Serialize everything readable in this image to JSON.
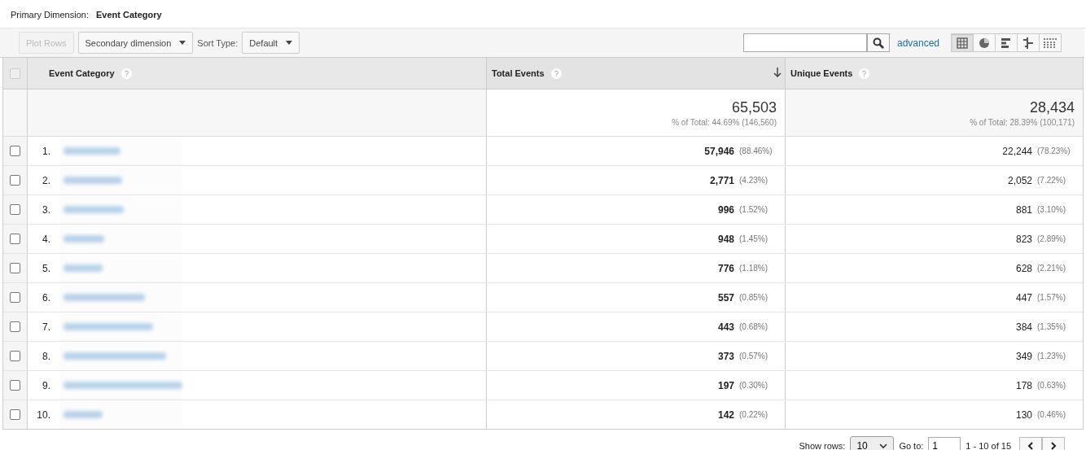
{
  "primary_dimension": {
    "label": "Primary Dimension:",
    "value": "Event Category"
  },
  "toolbar": {
    "plot_rows": {
      "label": "Plot Rows",
      "disabled": true
    },
    "secondary": "Secondary dimension",
    "sort_label": "Sort Type:",
    "sort_value": "Default",
    "advanced": "advanced",
    "views": [
      {
        "kind": "table",
        "selected": true
      },
      {
        "kind": "pie",
        "selected": false
      },
      {
        "kind": "bars",
        "selected": false
      },
      {
        "kind": "comparison",
        "selected": false
      },
      {
        "kind": "pivot",
        "selected": false
      }
    ]
  },
  "table": {
    "select_all_checked": false,
    "columns": [
      {
        "label": "Event Category",
        "sorted": false
      },
      {
        "label": "Total Events",
        "sorted": true
      },
      {
        "label": "Unique Events",
        "sorted": false
      }
    ],
    "totals": [
      {
        "value": "65,503",
        "detail": "% of Total: 44.69% (146,560)"
      },
      {
        "value": "28,434",
        "detail": "% of Total: 28.39% (100,171)"
      }
    ],
    "rows": [
      {
        "index": "1.",
        "checked": false,
        "total": "57,946",
        "total_pct": "(88.46%)",
        "unique": "22,244",
        "unique_pct": "(78.23%)"
      },
      {
        "index": "2.",
        "checked": false,
        "total": "2,771",
        "total_pct": "(4.23%)",
        "unique": "2,052",
        "unique_pct": "(7.22%)"
      },
      {
        "index": "3.",
        "checked": false,
        "total": "996",
        "total_pct": "(1.52%)",
        "unique": "881",
        "unique_pct": "(3.10%)"
      },
      {
        "index": "4.",
        "checked": false,
        "total": "948",
        "total_pct": "(1.45%)",
        "unique": "823",
        "unique_pct": "(2.89%)"
      },
      {
        "index": "5.",
        "checked": false,
        "total": "776",
        "total_pct": "(1.18%)",
        "unique": "628",
        "unique_pct": "(2.21%)"
      },
      {
        "index": "6.",
        "checked": false,
        "total": "557",
        "total_pct": "(0.85%)",
        "unique": "447",
        "unique_pct": "(1.57%)"
      },
      {
        "index": "7.",
        "checked": false,
        "total": "443",
        "total_pct": "(0.68%)",
        "unique": "384",
        "unique_pct": "(1.35%)"
      },
      {
        "index": "8.",
        "checked": false,
        "total": "373",
        "total_pct": "(0.57%)",
        "unique": "349",
        "unique_pct": "(1.23%)"
      },
      {
        "index": "9.",
        "checked": false,
        "total": "197",
        "total_pct": "(0.30%)",
        "unique": "178",
        "unique_pct": "(0.63%)"
      },
      {
        "index": "10.",
        "checked": false,
        "total": "142",
        "total_pct": "(0.22%)",
        "unique": "130",
        "unique_pct": "(0.46%)"
      }
    ]
  },
  "footer": {
    "show_rows_label": "Show rows:",
    "show_rows_value": "10",
    "goto_label": "Go to:",
    "goto_value": "1",
    "range": "1 - 10 of 15"
  }
}
